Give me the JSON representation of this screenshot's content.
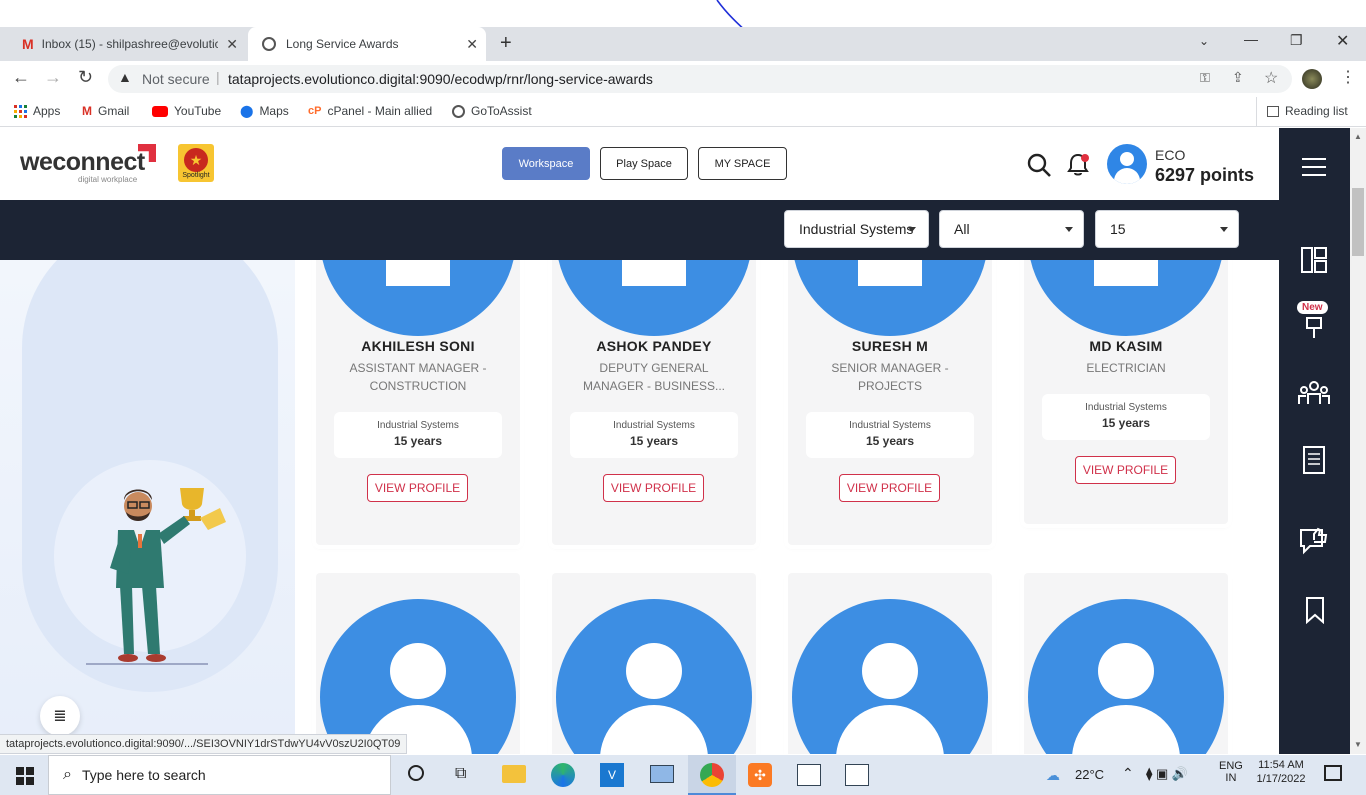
{
  "browser": {
    "tabs": [
      {
        "label": "Inbox (15) - shilpashree@evolutic"
      },
      {
        "label": "Long Service Awards"
      }
    ],
    "security": "Not secure",
    "url": "tataprojects.evolutionco.digital:9090/ecodwp/rnr/long-service-awards",
    "bookmarks": [
      "Apps",
      "Gmail",
      "YouTube",
      "Maps",
      "cPanel - Main allied",
      "GoToAssist"
    ],
    "reading_list": "Reading list"
  },
  "header": {
    "logo_text": "weconnect",
    "logo_sub": "digital workplace",
    "spotlight_label": "Spotlight",
    "buttons": [
      "Workspace",
      "Play Space",
      "MY SPACE"
    ],
    "user_name": "ECO",
    "points": "6297 points"
  },
  "filters": {
    "division": "Industrial Systems",
    "type": "All",
    "years": "15"
  },
  "cards_row1": [
    {
      "name": "AKHILESH SONI",
      "role": "ASSISTANT MANAGER - CONSTRUCTION",
      "dept": "Industrial Systems",
      "years": "15 years",
      "button": "VIEW PROFILE"
    },
    {
      "name": "ASHOK PANDEY",
      "role": "DEPUTY GENERAL MANAGER - BUSINESS...",
      "dept": "Industrial Systems",
      "years": "15 years",
      "button": "VIEW PROFILE"
    },
    {
      "name": "SURESH M",
      "role": "SENIOR MANAGER - PROJECTS",
      "dept": "Industrial Systems",
      "years": "15 years",
      "button": "VIEW PROFILE"
    },
    {
      "name": "MD KASIM",
      "role": "ELECTRICIAN",
      "dept": "Industrial Systems",
      "years": "15 years",
      "button": "VIEW PROFILE"
    }
  ],
  "sidebar": {
    "new_badge": "New"
  },
  "status_url": "tataprojects.evolutionco.digital:9090/.../SEI3OVNIY1drSTdwYU4vV0szU2I0QT09",
  "taskbar": {
    "search_placeholder": "Type here to search",
    "weather": "22°C",
    "lang1": "ENG",
    "lang2": "IN",
    "time": "11:54 AM",
    "date": "1/17/2022"
  },
  "colors": {
    "navy": "#1c2434",
    "accent_blue": "#5a7cc7",
    "avatar_blue": "#3d8ee3",
    "view_profile_red": "#d0314a"
  }
}
